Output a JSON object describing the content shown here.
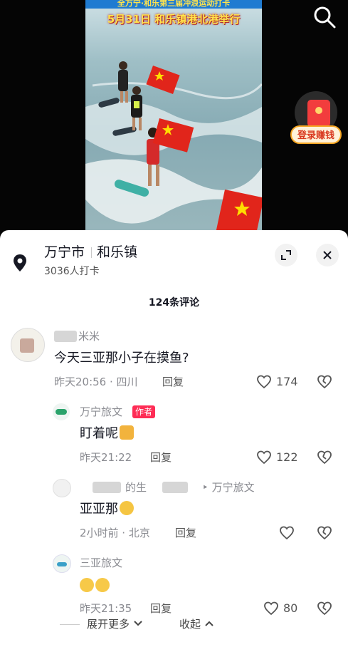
{
  "video": {
    "banner_top": "全万宁·和乐第三届冲浪运动打卡",
    "banner": "5月31日 和乐镇港北港举行",
    "reward_label": "登录赚钱"
  },
  "location": {
    "city": "万宁市",
    "town": "和乐镇",
    "checkins": "3036人打卡"
  },
  "comments_header": "124条评论",
  "comments": [
    {
      "name": "米米",
      "text": "今天三亚那小子在摸鱼?",
      "time_loc": "昨天20:56 · 四川",
      "reply": "回复",
      "likes": "174"
    },
    {
      "name": "万宁旅文",
      "tag": "作者",
      "text": "盯着呢",
      "time_loc": "昨天21:22",
      "reply": "回复",
      "likes": "122"
    },
    {
      "name": "的生",
      "name_tail": "‣ 万宁旅文",
      "text": "亚亚那",
      "time_loc": "2小时前 · 北京",
      "reply": "回复",
      "likes": ""
    },
    {
      "name": "三亚旅文",
      "text": "",
      "time_loc": "昨天21:35",
      "reply": "回复",
      "likes": "80"
    }
  ],
  "footer": {
    "expand_more": "展开更多",
    "collapse": "收起"
  },
  "colors": {
    "author_tag": "#fe2c55",
    "reward_text": "#d9381e",
    "flag_red": "#e1251b",
    "flag_star": "#ffde00"
  },
  "icons": [
    "search-icon",
    "red-envelope-icon",
    "location-pin-icon",
    "expand-icon",
    "close-icon",
    "heart-icon",
    "dislike-icon",
    "chevron-down-icon",
    "chevron-up-icon"
  ]
}
